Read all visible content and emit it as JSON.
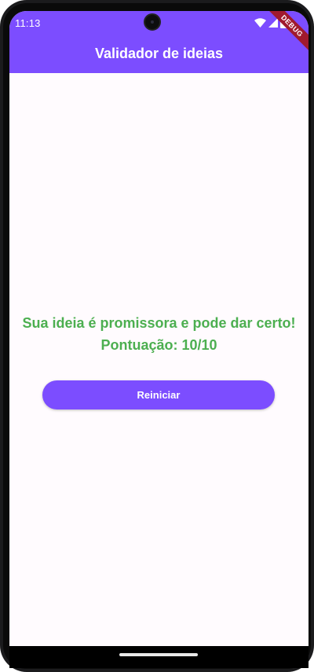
{
  "status_bar": {
    "time": "11:13",
    "debug_label": "DEBUG",
    "icons": [
      "wifi-icon",
      "cellular-signal-icon",
      "battery-icon"
    ]
  },
  "app_bar": {
    "title": "Validador de ideias"
  },
  "result": {
    "message": "Sua ideia é promissora e pode dar certo!",
    "score_text": "Pontuação: 10/10"
  },
  "actions": {
    "restart_label": "Reiniciar"
  },
  "colors": {
    "primary": "#7c4dff",
    "success": "#4caf50",
    "background": "#fffbfe",
    "ribbon": "#a01a2e"
  }
}
